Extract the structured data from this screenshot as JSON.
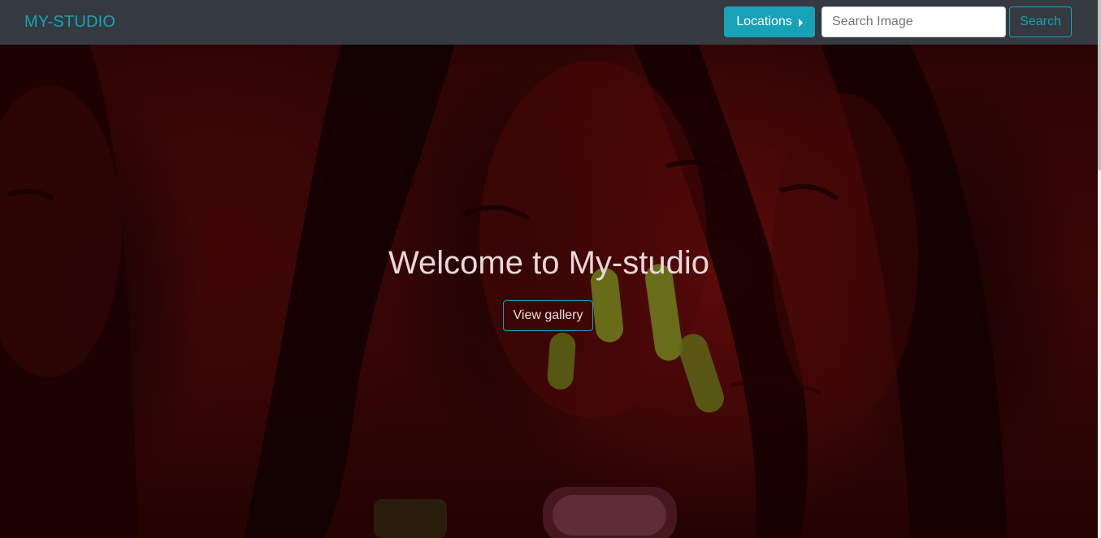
{
  "navbar": {
    "brand": "MY-STUDIO",
    "locations_label": "Locations",
    "search_placeholder": "Search Image",
    "search_value": "",
    "search_button": "Search"
  },
  "hero": {
    "title": "Welcome to My-studio",
    "cta_label": "View gallery"
  },
  "colors": {
    "navbar_bg": "#343a40",
    "accent": "#17a2b8",
    "hero_tint": "#3a0505"
  },
  "icons": {
    "locations_caret": "caret-right-icon"
  }
}
